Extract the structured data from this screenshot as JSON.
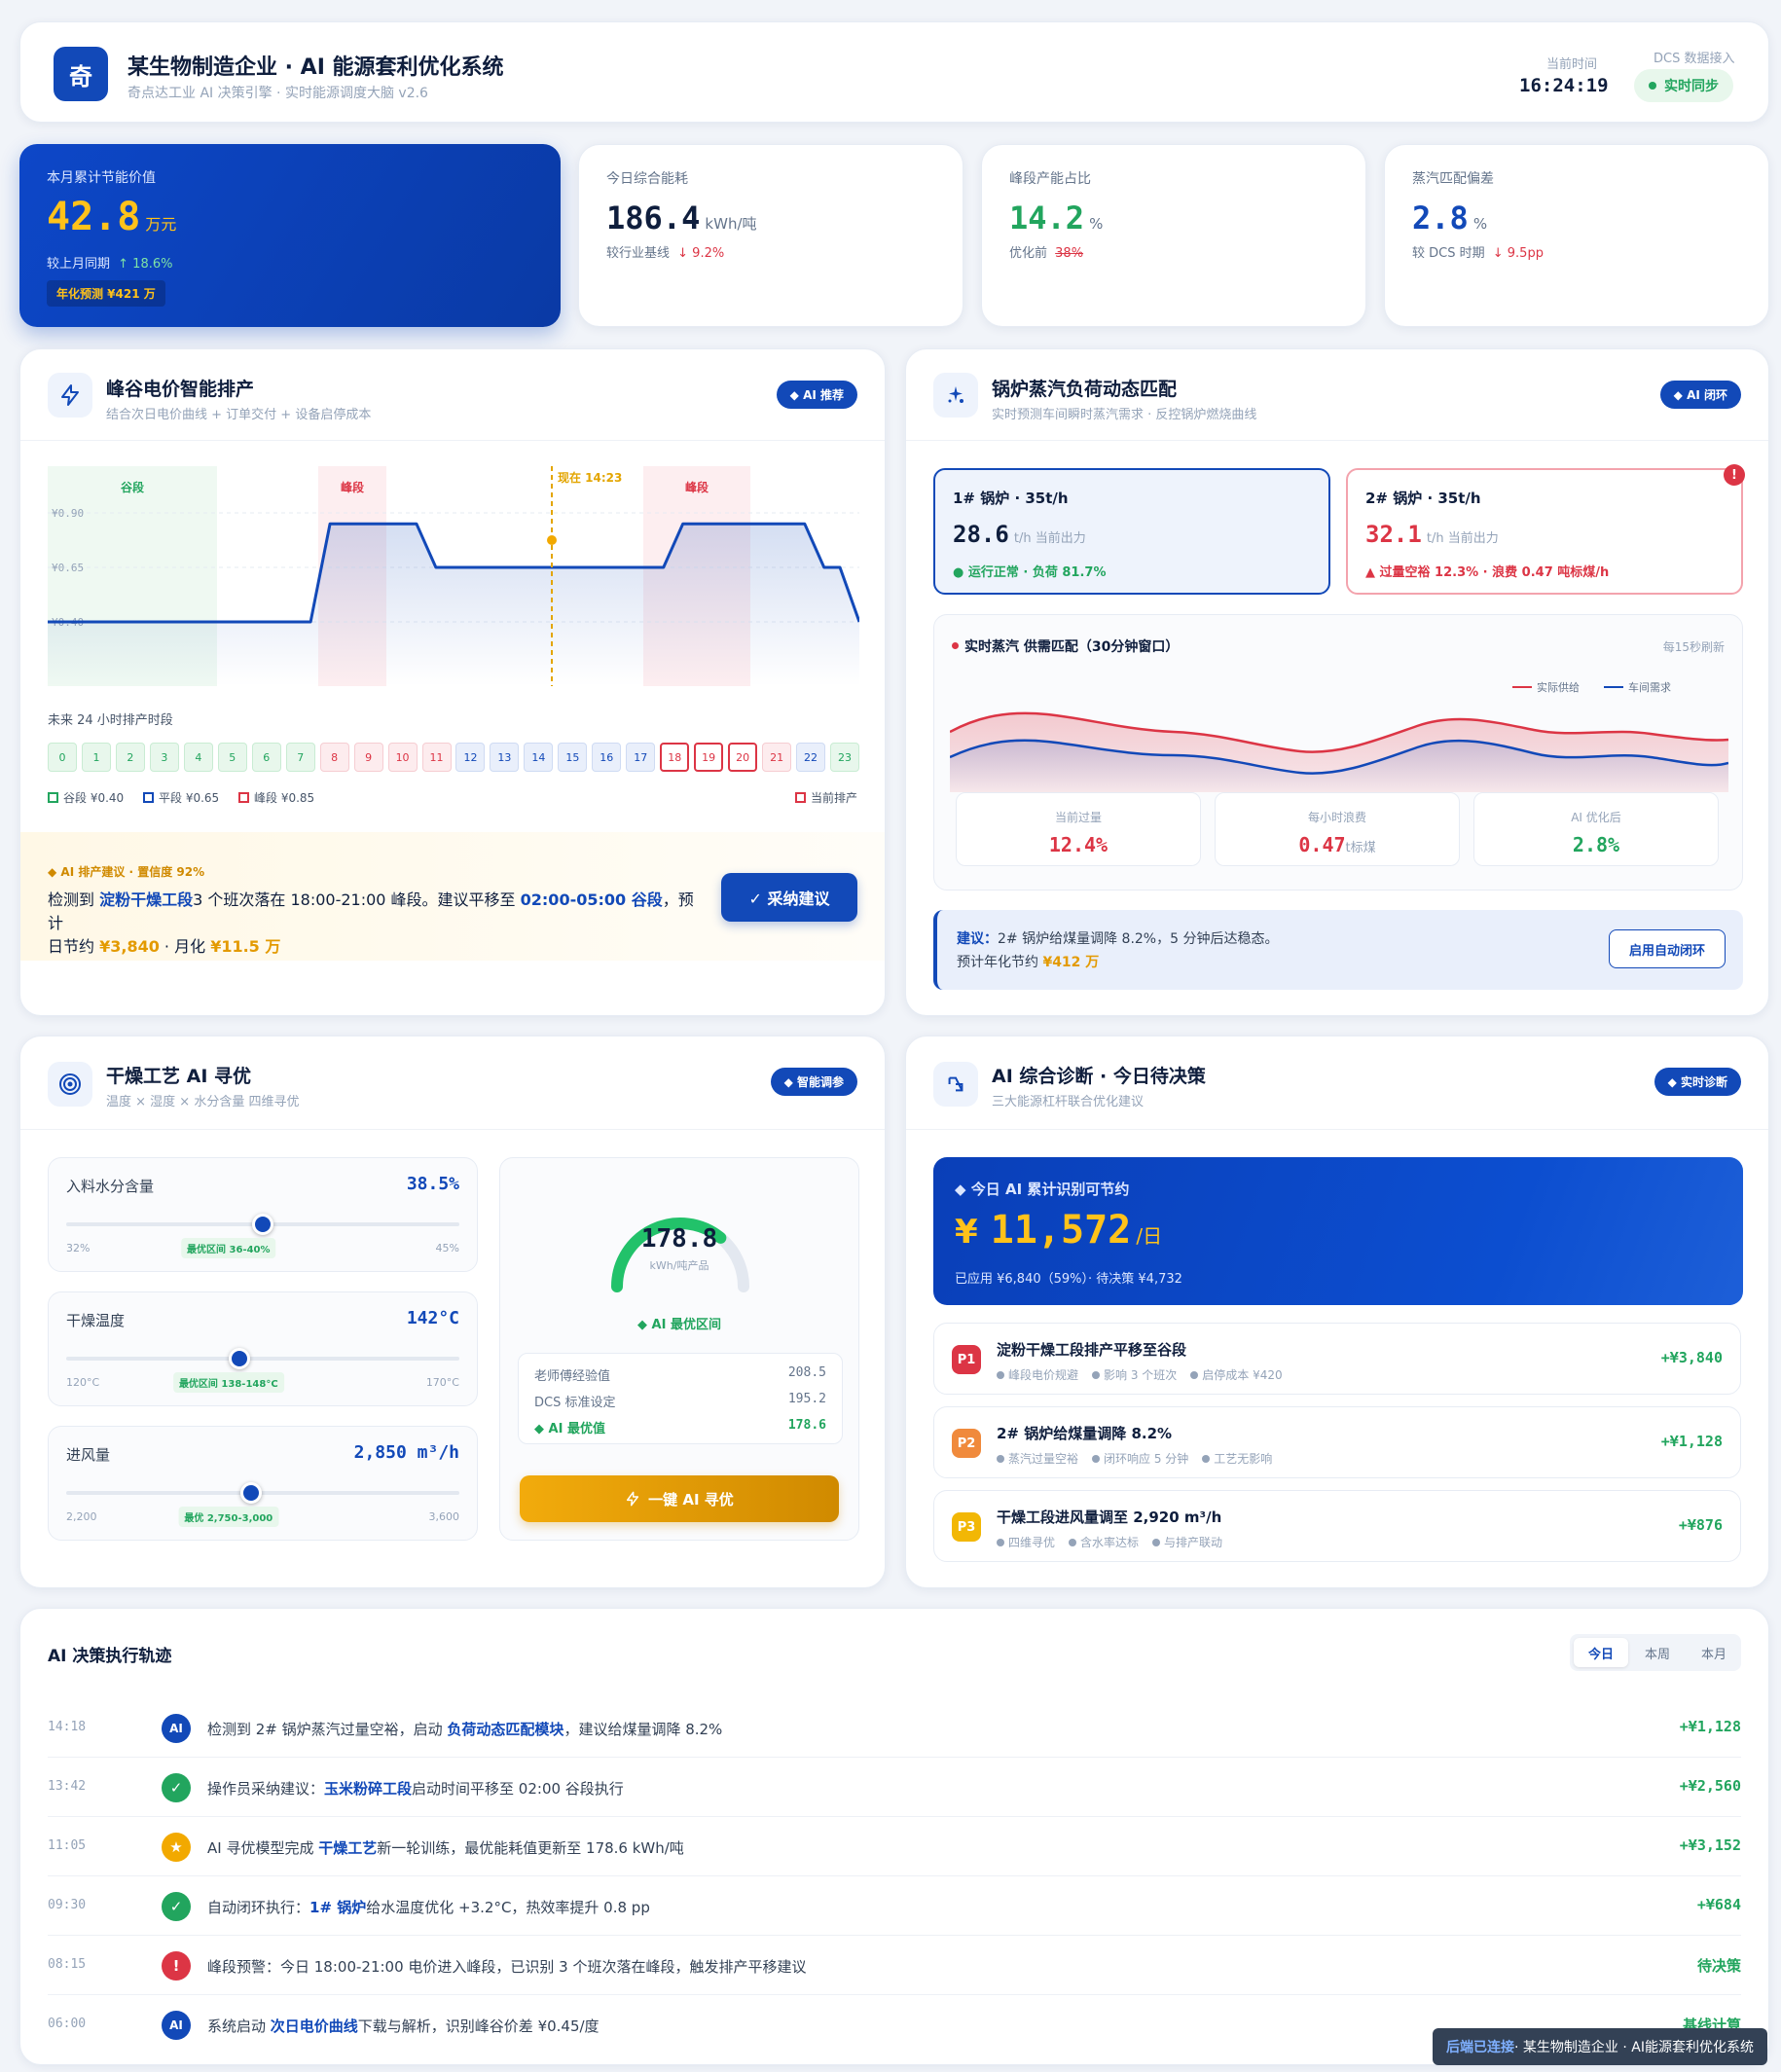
{
  "header": {
    "logo_char": "奇",
    "title": "某生物制造企业 · AI 能源套利优化系统",
    "subtitle": "奇点达工业 AI 决策引擎 · 实时能源调度大脑 v2.6",
    "time_label": "当前时间",
    "time_value": "16:24:19",
    "dcs_label": "DCS 数据接入",
    "dcs_status": "实时同步"
  },
  "kpis": {
    "savings": {
      "label": "本月累计节能价值",
      "value": "42.8",
      "unit": "万元",
      "compare_label": "较上月同期",
      "compare_value": "↑ 18.6%",
      "badge": "年化预测 ¥421 万"
    },
    "energy": {
      "label": "今日综合能耗",
      "value": "186.4",
      "unit": "kWh/吨",
      "compare_label": "较行业基线",
      "compare_value": "↓ 9.2%"
    },
    "peak": {
      "label": "峰段产能占比",
      "value": "14.2",
      "unit": "%",
      "compare_label": "优化前",
      "compare_value": "38%"
    },
    "steam": {
      "label": "蒸汽匹配偏差",
      "value": "2.8",
      "unit": "%",
      "compare_label": "较 DCS 时期",
      "compare_value": "↓ 9.5pp"
    }
  },
  "price_panel": {
    "title": "峰谷电价智能排产",
    "subtitle": "结合次日电价曲线 + 订单交付 + 设备启停成本",
    "badge": "◆ AI 推荐",
    "zone_valley": "谷段",
    "zone_peak": "峰段",
    "now_label": "现在 14:23",
    "y_ticks": [
      "¥0.90",
      "¥0.65",
      "¥0.40"
    ],
    "schedule_label": "未来 24 小时排产时段",
    "legend": [
      "谷段 ¥0.40",
      "平段 ¥0.65",
      "峰段 ¥0.85"
    ],
    "legend_current": "当前排产",
    "suggestion_head": "◆ AI 排产建议 · 置信度 92%",
    "suggestion_1": "检测到 ",
    "suggestion_link1": "淀粉干燥工段",
    "suggestion_2": "3 个班次落在 18:00-21:00 峰段。建议平移至 ",
    "suggestion_link2": "02:00-05:00 谷段",
    "suggestion_3": "，预计",
    "suggestion_4": "日节约 ",
    "suggestion_amt1": "¥3,840",
    "suggestion_5": " · 月化 ",
    "suggestion_amt2": "¥11.5 万",
    "accept_button": "✓ 采纳建议"
  },
  "price_curve": {
    "hours": [
      0,
      1,
      2,
      3,
      4,
      5,
      6,
      7,
      8,
      9,
      10,
      11,
      12,
      13,
      14,
      15,
      16,
      17,
      18,
      19,
      20,
      21,
      22,
      23
    ],
    "price": [
      0.4,
      0.4,
      0.4,
      0.4,
      0.4,
      0.4,
      0.4,
      0.4,
      0.85,
      0.85,
      0.85,
      0.65,
      0.65,
      0.65,
      0.65,
      0.65,
      0.65,
      0.65,
      0.85,
      0.85,
      0.85,
      0.85,
      0.65,
      0.4
    ]
  },
  "schedule_slots": [
    {
      "h": "0",
      "t": "valley"
    },
    {
      "h": "1",
      "t": "valley"
    },
    {
      "h": "2",
      "t": "valley"
    },
    {
      "h": "3",
      "t": "valley"
    },
    {
      "h": "4",
      "t": "valley"
    },
    {
      "h": "5",
      "t": "valley"
    },
    {
      "h": "6",
      "t": "valley"
    },
    {
      "h": "7",
      "t": "valley"
    },
    {
      "h": "8",
      "t": "peak"
    },
    {
      "h": "9",
      "t": "peak"
    },
    {
      "h": "10",
      "t": "peak"
    },
    {
      "h": "11",
      "t": "peak"
    },
    {
      "h": "12",
      "t": "flat"
    },
    {
      "h": "13",
      "t": "flat"
    },
    {
      "h": "14",
      "t": "flat"
    },
    {
      "h": "15",
      "t": "flat"
    },
    {
      "h": "16",
      "t": "flat"
    },
    {
      "h": "17",
      "t": "flat"
    },
    {
      "h": "18",
      "t": "cur"
    },
    {
      "h": "19",
      "t": "cur"
    },
    {
      "h": "20",
      "t": "cur"
    },
    {
      "h": "21",
      "t": "peak"
    },
    {
      "h": "22",
      "t": "flat"
    },
    {
      "h": "23",
      "t": "valley"
    }
  ],
  "boiler_panel": {
    "title": "锅炉蒸汽负荷动态匹配",
    "subtitle": "实时预测车间瞬时蒸汽需求 · 反控锅炉燃烧曲线",
    "badge": "◆ AI 闭环",
    "b1_title": "1# 锅炉 · 35t/h",
    "b1_value": "28.6",
    "b1_unit": "t/h 当前出力",
    "b1_status": "● 运行正常 · 负荷 81.7%",
    "b2_title": "2# 锅炉 · 35t/h",
    "b2_value": "32.1",
    "b2_unit": "t/h 当前出力",
    "b2_status": "▲ 过量空裕 12.3% · 浪费 0.47 吨标煤/h",
    "b2_alert": "!",
    "chart_title": "实时蒸汽 供需匹配（30分钟窗口）",
    "chart_refresh": "每15秒刷新",
    "legend_supply": "实际供给",
    "legend_demand": "车间需求",
    "stat1_label": "当前过量",
    "stat1_value": "12.4%",
    "stat2_label": "每小时浪费",
    "stat2_value": "0.47",
    "stat2_unit": "t标煤",
    "stat3_label": "AI 优化后",
    "stat3_value": "2.8%",
    "advice_head": "建议：",
    "advice_text": "2# 锅炉给煤量调降 8.2%，5 分钟后达稳态。",
    "advice_line2": "预计年化节约 ",
    "advice_amt": "¥412 万",
    "advice_button": "启用自动闭环"
  },
  "dry_panel": {
    "title": "干燥工艺 AI 寻优",
    "subtitle": "温度 × 湿度 × 水分含量 四维寻优",
    "badge": "◆ 智能调参",
    "sliders": [
      {
        "label": "入料水分含量",
        "value": "38.5%",
        "min": "32%",
        "max": "45%",
        "opt": "最优区间 36-40%",
        "pos": 0.5
      },
      {
        "label": "干燥温度",
        "value": "142°C",
        "min": "120°C",
        "max": "170°C",
        "opt": "最优区间 138-148°C",
        "pos": 0.44
      },
      {
        "label": "进风量",
        "value": "2,850 m³/h",
        "min": "2,200",
        "max": "3,600",
        "opt": "最优 2,750-3,000",
        "pos": 0.47
      }
    ],
    "gauge_value": "178.8",
    "gauge_unit": "kWh/吨产品",
    "gauge_fill": 0.72,
    "gauge_label": "◆ AI 最优区间",
    "compare": [
      {
        "k": "老师傅经验值",
        "v": "208.5"
      },
      {
        "k": "DCS 标准设定",
        "v": "195.2"
      },
      {
        "k": "◆ AI 最优值",
        "v": "178.6"
      }
    ],
    "optimize_button": "一键 AI 寻优"
  },
  "diag_panel": {
    "title": "AI 综合诊断 · 今日待决策",
    "subtitle": "三大能源杠杆联合优化建议",
    "badge": "◆ 实时诊断",
    "banner_label": "◆ 今日 AI 累计识别可节约",
    "banner_currency": "¥",
    "banner_value": "11,572",
    "banner_unit": "/日",
    "banner_sub": "已应用 ¥6,840（59%）· 待决策 ¥4,732",
    "decisions": [
      {
        "pri": "P1",
        "color": "#dc3545",
        "title": "淀粉干燥工段排产平移至谷段",
        "tags": [
          "峰段电价规避",
          "影响 3 个班次",
          "启停成本 ¥420"
        ],
        "amt": "+¥3,840"
      },
      {
        "pri": "P2",
        "color": "#f08a3c",
        "title": "2# 锅炉给煤量调降 8.2%",
        "tags": [
          "蒸汽过量空裕",
          "闭环响应 5 分钟",
          "工艺无影响"
        ],
        "amt": "+¥1,128"
      },
      {
        "pri": "P3",
        "color": "#f2b705",
        "title": "干燥工段进风量调至 2,920 m³/h",
        "tags": [
          "四维寻优",
          "含水率达标",
          "与排产联动"
        ],
        "amt": "+¥876"
      }
    ]
  },
  "timeline": {
    "title": "AI 决策执行轨迹",
    "tabs": [
      "今日",
      "本周",
      "本月"
    ],
    "rows": [
      {
        "time": "14:18",
        "icon": "AI",
        "color": "#1249b8",
        "pre": "检测到 2# 锅炉蒸汽过量空裕，启动 ",
        "link": "负荷动态匹配模块",
        "post": "，建议给煤量调降 8.2%",
        "amt": "+¥1,128"
      },
      {
        "time": "13:42",
        "icon": "✓",
        "color": "#22a55e",
        "pre": "操作员采纳建议：",
        "link": "玉米粉碎工段",
        "post": "启动时间平移至 02:00 谷段执行",
        "amt": "+¥2,560"
      },
      {
        "time": "11:05",
        "icon": "★",
        "color": "#f2a900",
        "pre": "AI 寻优模型完成 ",
        "link": "干燥工艺",
        "post": "新一轮训练，最优能耗值更新至 178.6 kWh/吨",
        "amt": "+¥3,152"
      },
      {
        "time": "09:30",
        "icon": "✓",
        "color": "#22a55e",
        "pre": "自动闭环执行：",
        "link": "1# 锅炉",
        "post": "给水温度优化 +3.2°C，热效率提升 0.8 pp",
        "amt": "+¥684"
      },
      {
        "time": "08:15",
        "icon": "!",
        "color": "#dc3545",
        "pre": "峰段预警：今日 18:00-21:00 电价进入峰段，已识别 3 个班次落在峰段，触发排产平移建议",
        "link": "",
        "post": "",
        "amt": "待决策"
      },
      {
        "time": "06:00",
        "icon": "AI",
        "color": "#1249b8",
        "pre": "系统启动 ",
        "link": "次日电价曲线",
        "post": "下载与解析，识别峰谷价差 ¥0.45/度",
        "amt": "基线计算"
      }
    ]
  },
  "footer": {
    "conn": "后端已连接",
    "text": " · 某生物制造企业 · AI能源套利优化系统"
  },
  "colors": {
    "primary": "#1249b8",
    "success": "#22a55e",
    "danger": "#dc3545",
    "gold": "#f2a900"
  }
}
